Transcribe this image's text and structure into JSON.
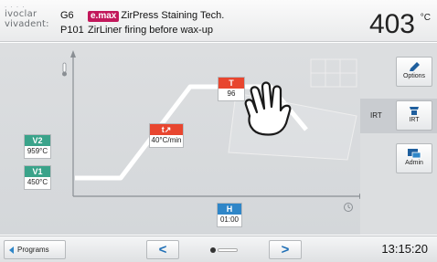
{
  "header": {
    "logo_line1": "ivoclar",
    "logo_line2": "vivadent:",
    "program_short": "G6",
    "brand_badge": "e.max",
    "program_title": "ZirPress Staining Tech.",
    "program_number": "P101",
    "program_desc": "ZirLiner firing before wax-up",
    "temperature": "403",
    "temperature_unit": "°C"
  },
  "steps": {
    "v2": {
      "caption": "V2",
      "value": "959°C"
    },
    "v1": {
      "caption": "V1",
      "value": "450°C"
    },
    "t_rate": {
      "caption": "t↗",
      "value": "40°C/min"
    },
    "T_top": {
      "caption": "T",
      "value": "96"
    },
    "H": {
      "caption": "H",
      "value": "01:00"
    }
  },
  "side_buttons": {
    "options_label": "Options",
    "irt_label": "IRT",
    "irt_panel_label": "IRT",
    "admin_label": "Admin"
  },
  "footer": {
    "programs_label": "Programs",
    "prev_glyph": "<",
    "next_glyph": ">",
    "clock": "13:15:20"
  },
  "icons": {
    "thermometer": "thermometer-icon",
    "clock": "clock-icon",
    "pen": "pen-icon",
    "irt": "irt-icon",
    "admin": "admin-icon",
    "hand": "hand-pointer-icon"
  },
  "colors": {
    "accent_blue": "#2f86c8",
    "step_red": "#e8462f",
    "step_green": "#3aa38a",
    "brand_magenta": "#c2185b"
  }
}
